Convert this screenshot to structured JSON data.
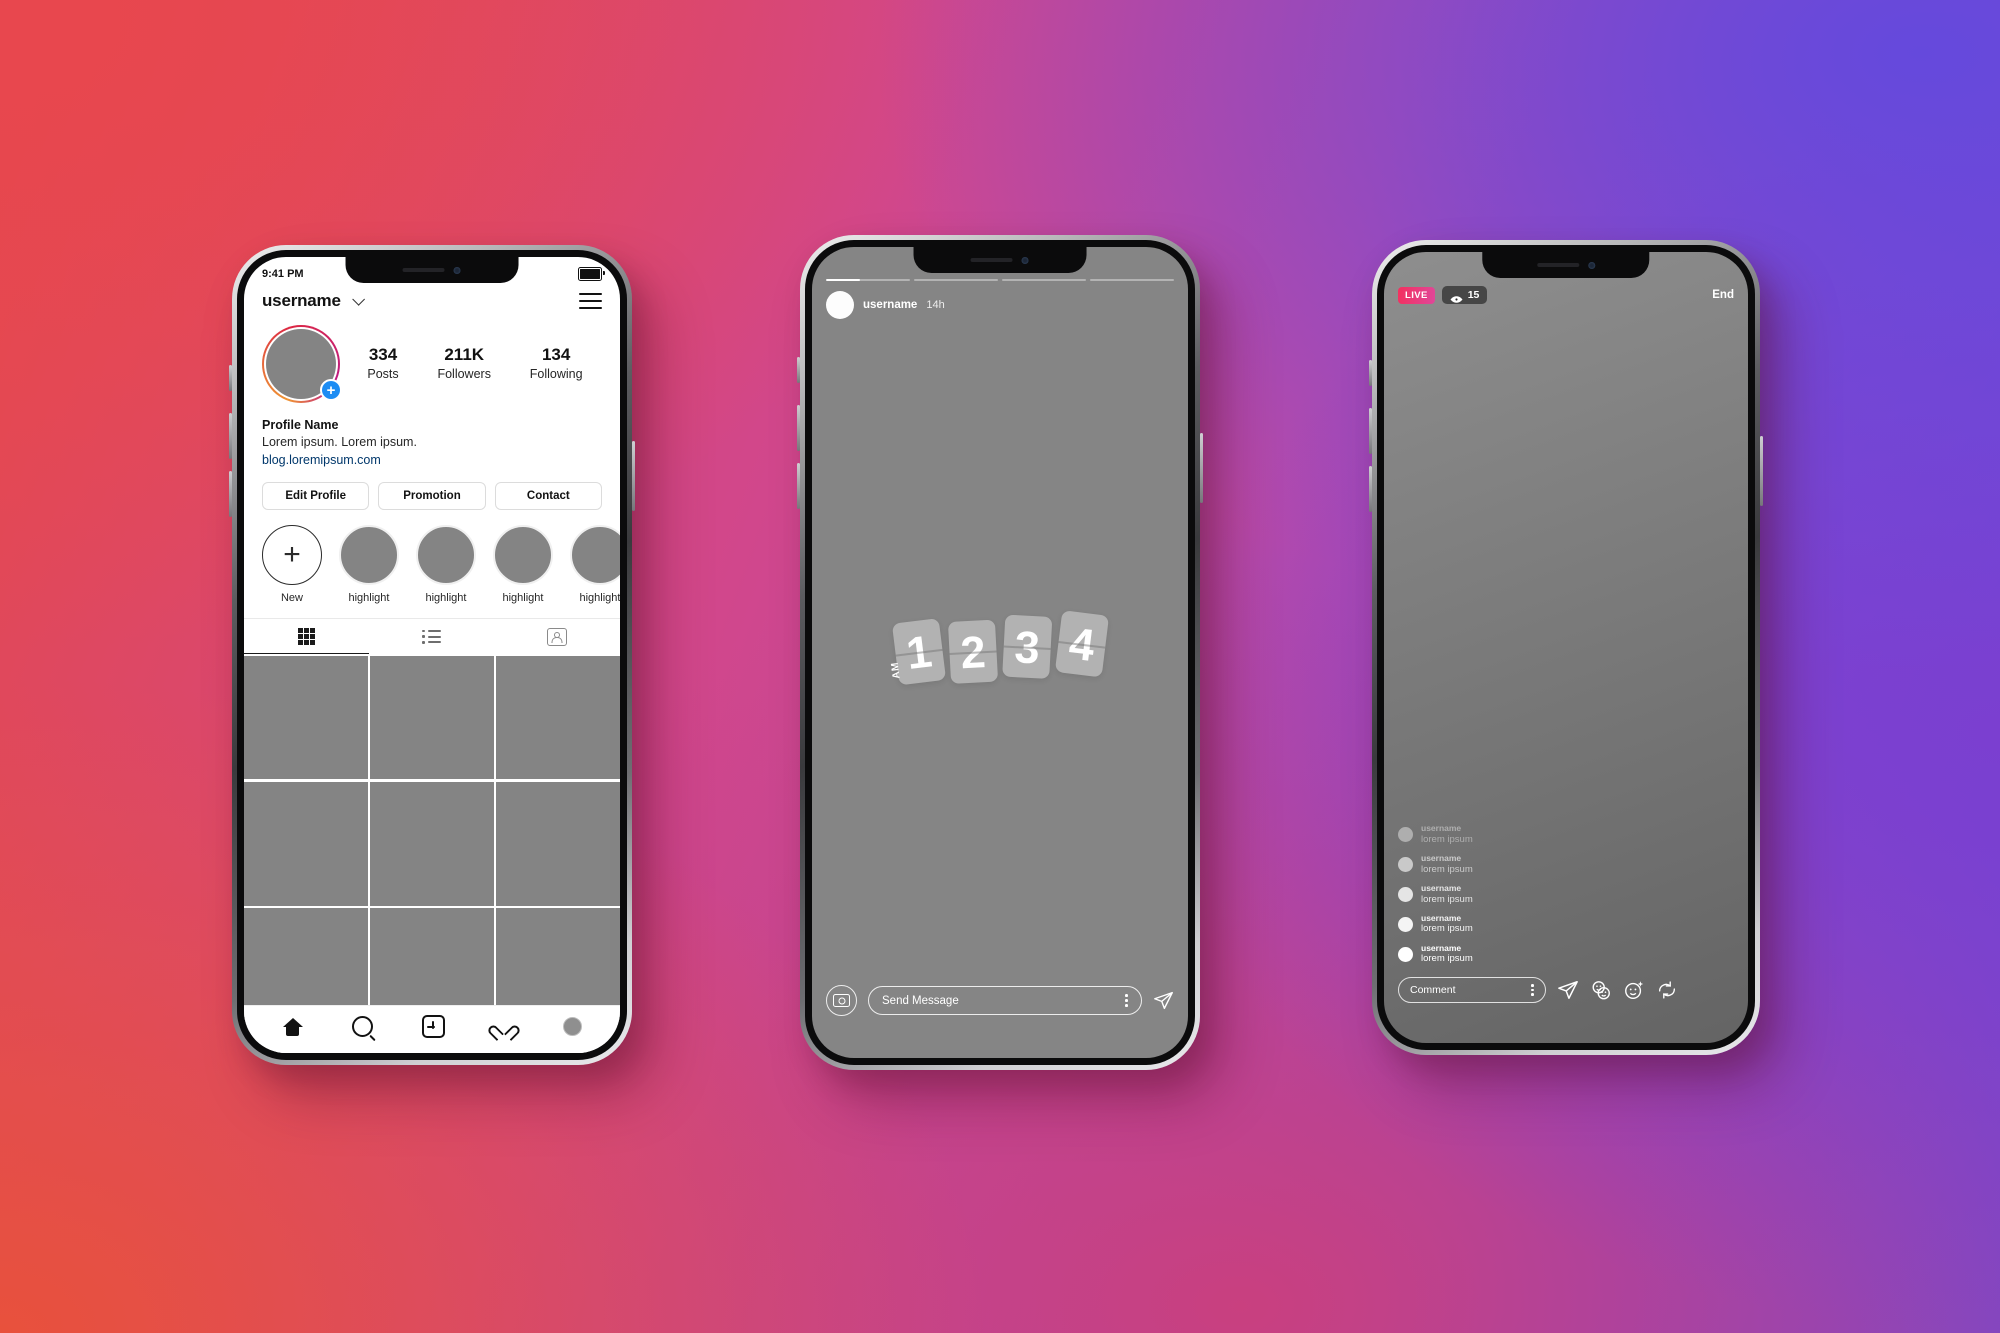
{
  "background": {
    "colors": [
      "#E8474E",
      "#E8513C",
      "#C04A96",
      "#8347CF",
      "#6549DC"
    ]
  },
  "phone_profile": {
    "status_bar": {
      "time": "9:41 PM",
      "battery_icon": "battery-full-icon"
    },
    "nav": {
      "username": "username",
      "chevron_icon": "chevron-down-icon",
      "menu_icon": "hamburger-menu-icon"
    },
    "avatar": {
      "add_badge": "+",
      "badge_icon": "add-story-plus-icon"
    },
    "stats": [
      {
        "value": "334",
        "label": "Posts"
      },
      {
        "value": "211K",
        "label": "Followers"
      },
      {
        "value": "134",
        "label": "Following"
      }
    ],
    "bio": {
      "name": "Profile Name",
      "text": "Lorem ipsum. Lorem ipsum.",
      "link": "blog.loremipsum.com"
    },
    "action_buttons": [
      "Edit Profile",
      "Promotion",
      "Contact"
    ],
    "highlights": [
      {
        "label": "New",
        "type": "new",
        "icon": "plus-icon"
      },
      {
        "label": "highlight",
        "type": "story"
      },
      {
        "label": "highlight",
        "type": "story"
      },
      {
        "label": "highlight",
        "type": "story"
      },
      {
        "label": "highlight",
        "type": "story"
      }
    ],
    "content_tabs": [
      {
        "icon": "grid-icon",
        "active": true
      },
      {
        "icon": "list-icon",
        "active": false
      },
      {
        "icon": "tagged-photos-icon",
        "active": false
      }
    ],
    "grid_cells": 9,
    "bottom_nav": [
      {
        "icon": "home-icon",
        "active": true
      },
      {
        "icon": "search-icon",
        "active": false
      },
      {
        "icon": "add-post-icon",
        "active": false
      },
      {
        "icon": "heart-icon",
        "active": false
      },
      {
        "icon": "profile-avatar-icon",
        "active": false
      }
    ]
  },
  "phone_story": {
    "progress_segments": [
      40,
      0,
      0,
      0
    ],
    "header": {
      "username": "username",
      "time": "14h",
      "avatar_icon": "story-avatar-icon"
    },
    "clock_sticker": {
      "ampm": "AM",
      "digits": [
        "1",
        "2",
        "3",
        "4"
      ],
      "display": "12:34"
    },
    "footer": {
      "camera_icon": "camera-icon",
      "message_placeholder": "Send Message",
      "more_icon": "more-vertical-icon",
      "send_icon": "send-paper-plane-icon"
    }
  },
  "phone_live": {
    "top_bar": {
      "live_label": "LIVE",
      "viewer_icon": "eye-icon",
      "viewer_count": "15",
      "end_label": "End"
    },
    "comments": [
      {
        "username": "username",
        "message": "lorem ipsum"
      },
      {
        "username": "username",
        "message": "lorem ipsum"
      },
      {
        "username": "username",
        "message": "lorem ipsum"
      },
      {
        "username": "username",
        "message": "lorem ipsum"
      },
      {
        "username": "username",
        "message": "lorem ipsum"
      }
    ],
    "footer": {
      "comment_placeholder": "Comment",
      "more_icon": "more-vertical-icon",
      "send_icon": "send-paper-plane-icon",
      "add-guest_icon": "add-guest-faces-icon",
      "filters_icon": "face-filters-icon",
      "flip_icon": "flip-camera-icon"
    }
  }
}
